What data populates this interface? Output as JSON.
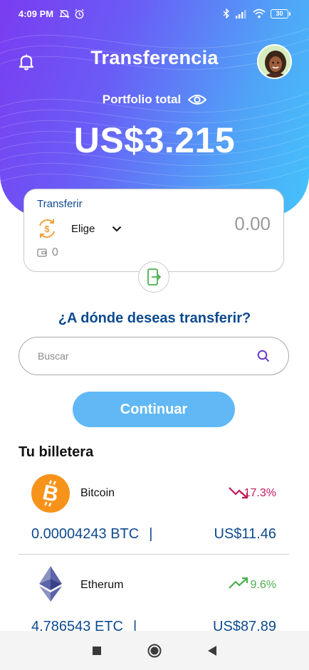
{
  "status_bar": {
    "time": "4:09 PM",
    "battery": "30",
    "icons": [
      "mute-icon",
      "alarm-icon",
      "bluetooth-icon",
      "signal-icon",
      "wifi-icon",
      "battery-icon"
    ]
  },
  "header": {
    "title": "Transferencia",
    "portfolio_label": "Portfolio total",
    "balance": "US$3.215"
  },
  "transfer_card": {
    "label": "Transferir",
    "select_value": "Elige",
    "amount": "0.00",
    "wallet_balance": "0"
  },
  "destination": {
    "question": "¿A dónde deseas transferir?",
    "search_placeholder": "Buscar",
    "continue_label": "Continuar"
  },
  "wallet": {
    "title": "Tu billetera",
    "assets": [
      {
        "name": "Bitcoin",
        "change": "-17.3%",
        "trend": "down",
        "amount": "0.00004243 BTC",
        "separator": "|",
        "usd": "US$11.46"
      },
      {
        "name": "Etherum",
        "change": "9.6%",
        "trend": "up",
        "amount": "4.786543 ETC",
        "separator": "|",
        "usd": "US$87.89"
      }
    ]
  },
  "colors": {
    "brand_blue": "#0d4a8f",
    "continue_button": "#61b8f5",
    "negative": "#c2185b",
    "positive": "#4caf50",
    "bitcoin": "#f7931a",
    "coin_icon": "#f0a03c"
  }
}
